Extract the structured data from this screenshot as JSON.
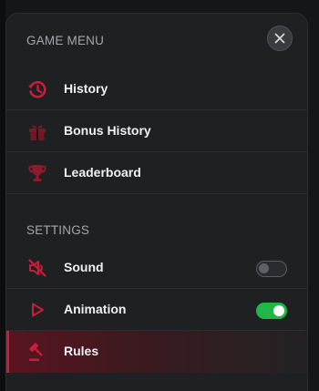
{
  "menu": {
    "title": "GAME MENU",
    "close_icon": "close-icon",
    "items": [
      {
        "label": "History",
        "icon": "history-icon"
      },
      {
        "label": "Bonus History",
        "icon": "gift-icon"
      },
      {
        "label": "Leaderboard",
        "icon": "trophy-icon"
      }
    ]
  },
  "settings": {
    "title": "SETTINGS",
    "items": [
      {
        "label": "Sound",
        "icon": "sound-muted-icon",
        "enabled": false
      },
      {
        "label": "Animation",
        "icon": "play-icon",
        "enabled": true
      },
      {
        "label": "Rules",
        "icon": "gavel-icon",
        "active": true
      }
    ]
  },
  "colors": {
    "accent": "#c81e3a",
    "toggle_on": "#20b74a",
    "panel_bg": "#1f2022"
  }
}
